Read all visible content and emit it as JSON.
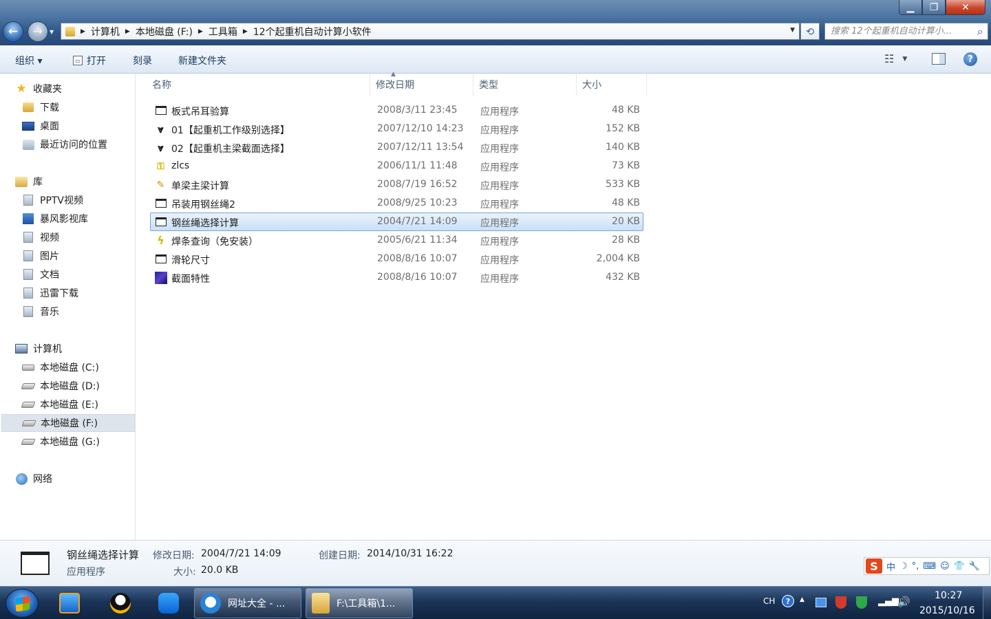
{
  "window": {
    "title_buttons": {
      "minimize": "▁",
      "maximize": "❐",
      "close": "✕"
    }
  },
  "navigation": {
    "back_glyph": "←",
    "forward_glyph": "→",
    "dropdown_glyph": "▼"
  },
  "address": {
    "breadcrumbs": [
      "计算机",
      "本地磁盘 (F:)",
      "工具箱",
      "12个起重机自动计算小软件"
    ],
    "separator": "▶",
    "dropdown_glyph": "▼",
    "refresh_glyph": "⟲"
  },
  "search": {
    "placeholder": "搜索 12个起重机自动计算小...",
    "icon": "search-icon"
  },
  "toolbar": {
    "organize": "组织 ▾",
    "open": "打开",
    "burn": "刻录",
    "new_folder": "新建文件夹",
    "views_glyph": "☷",
    "views_dd": "▼",
    "help": "?"
  },
  "sidebar": {
    "favorites": {
      "label": "收藏夹",
      "items": [
        "下载",
        "桌面",
        "最近访问的位置"
      ]
    },
    "libraries": {
      "label": "库",
      "items": [
        "PPTV视频",
        "暴风影视库",
        "视频",
        "图片",
        "文档",
        "迅雷下载",
        "音乐"
      ]
    },
    "computer": {
      "label": "计算机",
      "items": [
        "本地磁盘 (C:)",
        "本地磁盘 (D:)",
        "本地磁盘 (E:)",
        "本地磁盘 (F:)",
        "本地磁盘 (G:)"
      ],
      "selected": "本地磁盘 (F:)"
    },
    "network": {
      "label": "网络"
    }
  },
  "columns": {
    "name": "名称",
    "date": "修改日期",
    "type": "类型",
    "size": "大小",
    "sort_glyph": "▲"
  },
  "files": [
    {
      "name": "板式吊耳验算",
      "date": "2008/3/11 23:45",
      "type": "应用程序",
      "size": "48 KB",
      "icon": "app-window-icon"
    },
    {
      "name": "01【起重机工作级别选择】",
      "date": "2007/12/10 14:23",
      "type": "应用程序",
      "size": "152 KB",
      "icon": "v-logo-icon"
    },
    {
      "name": "02【起重机主梁截面选择】",
      "date": "2007/12/11 13:54",
      "type": "应用程序",
      "size": "140 KB",
      "icon": "v-logo-icon"
    },
    {
      "name": "zlcs",
      "date": "2006/11/1 11:48",
      "type": "应用程序",
      "size": "73 KB",
      "icon": "key-icon"
    },
    {
      "name": "单梁主梁计算",
      "date": "2008/7/19 16:52",
      "type": "应用程序",
      "size": "533 KB",
      "icon": "ruler-icon"
    },
    {
      "name": "吊装用钢丝绳2",
      "date": "2008/9/25 10:23",
      "type": "应用程序",
      "size": "48 KB",
      "icon": "app-window-icon"
    },
    {
      "name": "钢丝绳选择计算",
      "date": "2004/7/21 14:09",
      "type": "应用程序",
      "size": "20 KB",
      "icon": "app-window-icon",
      "selected": true
    },
    {
      "name": "焊条查询（免安装）",
      "date": "2005/6/21 11:34",
      "type": "应用程序",
      "size": "28 KB",
      "icon": "bolt-icon"
    },
    {
      "name": "滑轮尺寸",
      "date": "2008/8/16 10:07",
      "type": "应用程序",
      "size": "2,004 KB",
      "icon": "app-window-icon"
    },
    {
      "name": "截面特性",
      "date": "2008/8/16 10:07",
      "type": "应用程序",
      "size": "432 KB",
      "icon": "section-icon"
    }
  ],
  "details": {
    "name": "钢丝绳选择计算",
    "type": "应用程序",
    "modified_label": "修改日期:",
    "modified_value": "2004/7/21 14:09",
    "created_label": "创建日期:",
    "created_value": "2014/10/31 16:22",
    "size_label": "大小:",
    "size_value": "20.0 KB"
  },
  "ime": {
    "logo": "S",
    "mode": "中",
    "moon": "☽",
    "punct": "°,",
    "keyboard": "⌨",
    "user": "☺",
    "shirt": "👕",
    "wrench": "🔧"
  },
  "taskbar": {
    "tasks": [
      {
        "label": "网址大全 - ...",
        "icon": "browser-icon"
      },
      {
        "label": "F:\\工具箱\\1...",
        "icon": "folder-icon"
      }
    ],
    "tray": {
      "lang": "CH",
      "help": "?",
      "expand": "▲",
      "signal": "▂▄▆",
      "volume": "🔊"
    },
    "clock": {
      "time": "10:27",
      "date": "2015/10/16"
    }
  }
}
